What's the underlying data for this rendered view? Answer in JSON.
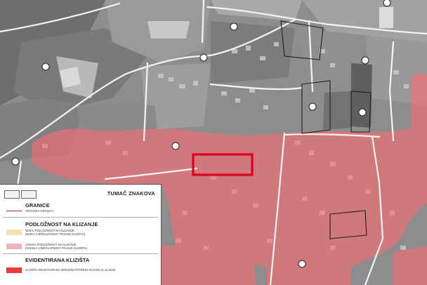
{
  "legend": {
    "logos": [
      "",
      ""
    ],
    "title": "TUMAČ ZNAKOVA",
    "sections": {
      "boundaries": "GRANICE",
      "susceptibility": "PODLOŽNOST NA KLIZANJE",
      "recorded": "EVIDENTIRANA KLIZIŠTA"
    },
    "items": {
      "city_boundary": "GRADSKA GRANICA",
      "low_line1": "NISKA PODLOŽNOST NA KLIZANJE",
      "low_line2": "(NISKA VJEROJATNOST POJAVE KLIZIŠTA)",
      "high_line1": "VISOKA PODLOŽNOST NA KLIZANJE",
      "high_line2": "(VISOKA VJEROJATNOST POJAVE KLIZIŠTA)",
      "reactivated": "KLIZIŠTA REAKTIVIRANA SERIJOM POTRESA NAKON 21.12.2020."
    },
    "colors": {
      "city_boundary": "#a33a3a",
      "low_susceptibility": "#efe3b4",
      "high_susceptibility": "#f2b3b6",
      "reactivated": "#ea3a3e"
    }
  },
  "map": {
    "type": "grayscale orthophoto with landslide susceptibility overlay",
    "overlay_color": "#ff6b73",
    "highlight_color": "#e0001b"
  }
}
